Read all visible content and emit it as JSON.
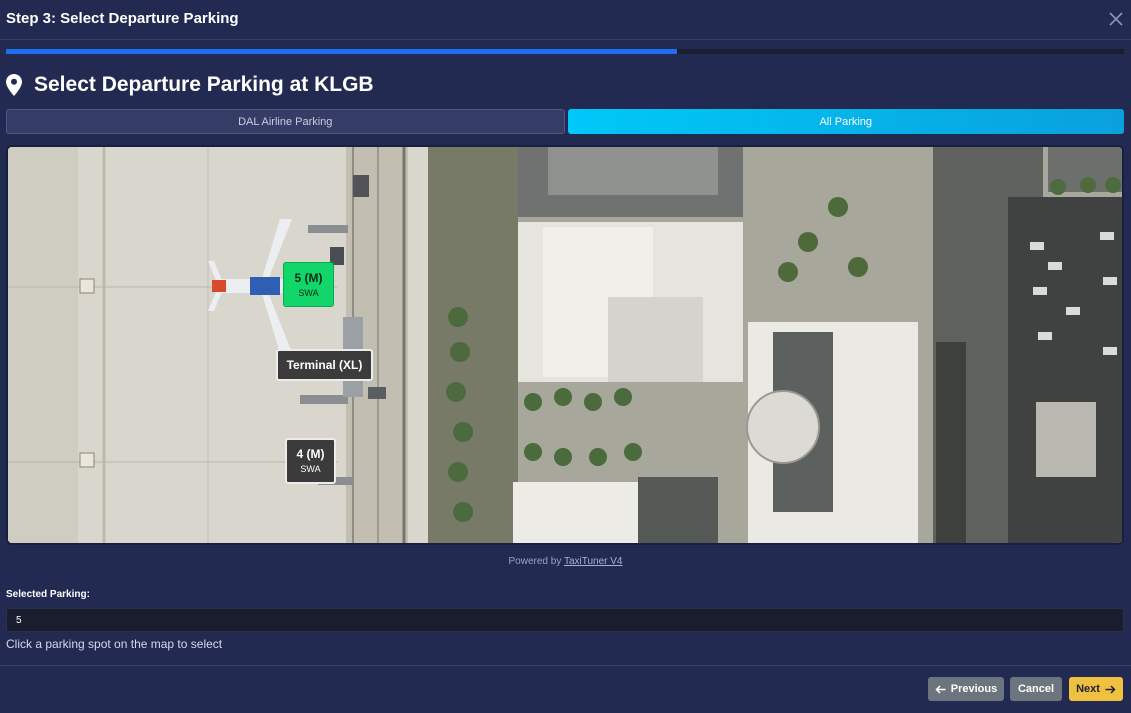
{
  "modal": {
    "title": "Step 3: Select Departure Parking",
    "progress_percent": 60
  },
  "section": {
    "icon": "map-pin-icon",
    "title": "Select Departure Parking at KLGB"
  },
  "tabs": [
    {
      "label": "DAL Airline Parking",
      "active": false
    },
    {
      "label": "All Parking",
      "active": true
    }
  ],
  "map": {
    "markers": [
      {
        "code": "5 (M)",
        "airline": "SWA",
        "selected": true
      },
      {
        "code": "Terminal (XL)",
        "airline": "",
        "selected": false
      },
      {
        "code": "4 (M)",
        "airline": "SWA",
        "selected": false
      }
    ]
  },
  "powered": {
    "prefix": "Powered by",
    "link": "TaxiTuner V4"
  },
  "selection": {
    "label": "Selected Parking:",
    "value": "5",
    "hint": "Click a parking spot on the map to select"
  },
  "buttons": {
    "previous": "Previous",
    "cancel": "Cancel",
    "next": "Next"
  },
  "colors": {
    "background": "#232a52",
    "progress": "#1e6ff0",
    "active_tab": "#00c8f8",
    "selected_marker": "#12d66a",
    "next_button": "#f0c040"
  }
}
